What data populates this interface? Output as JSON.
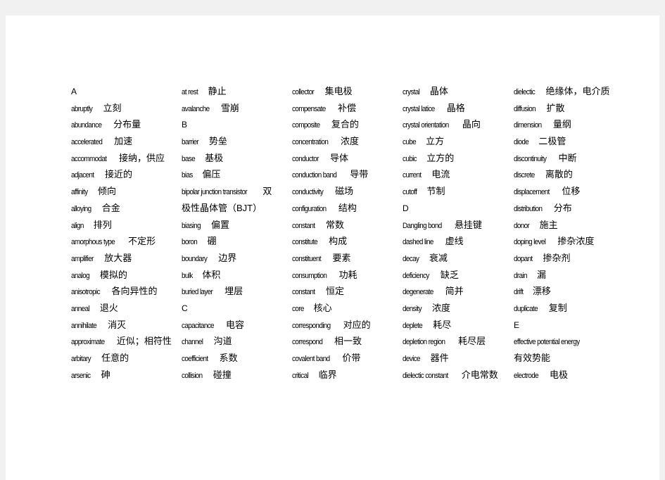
{
  "columns": [
    [
      {
        "heading": "A"
      },
      {
        "en": "abruptly",
        "zh": "立刻"
      },
      {
        "en": "abundance",
        "zh": "分布量"
      },
      {
        "en": "accelerated",
        "zh": "加速"
      },
      {
        "en": "accommodat",
        "zh": "接纳，供应"
      },
      {
        "en": "adjacent",
        "zh": "接近的"
      },
      {
        "en": "affinity",
        "zh": "倾向"
      },
      {
        "en": "alloying",
        "zh": "合金"
      },
      {
        "en": "align",
        "zh": "排列"
      },
      {
        "en": "amorphous type",
        "zh": "不定形"
      },
      {
        "en": "amplifier",
        "zh": "放大器"
      },
      {
        "en": "analog",
        "zh": "模拟的"
      },
      {
        "en": "anisotropic",
        "zh": "各向异性的"
      },
      {
        "en": "anneal",
        "zh": "退火"
      },
      {
        "en": "annihilate",
        "zh": "消灭"
      },
      {
        "en": "approximate",
        "zh": "近似；相符性"
      },
      {
        "en": "arbitary",
        "zh": "任意的"
      },
      {
        "en": "arsenic",
        "zh": "砷"
      }
    ],
    [
      {
        "en": "at rest",
        "zh": "静止"
      },
      {
        "en": "avalanche",
        "zh": "雪崩"
      },
      {
        "heading": "B"
      },
      {
        "en": "barrier",
        "zh": "势垒"
      },
      {
        "en": "base",
        "zh": "基极"
      },
      {
        "en": "bias",
        "zh": "偏压"
      },
      {
        "en": "bipolar junction transistor",
        "zh": "双"
      },
      {
        "zh": "极性晶体管（BJT）"
      },
      {
        "en": "biasing",
        "zh": "偏置"
      },
      {
        "en": "boron",
        "zh": "硼"
      },
      {
        "en": "boundary",
        "zh": "边界"
      },
      {
        "en": "bulk",
        "zh": "体积"
      },
      {
        "en": "buried layer",
        "zh": "埋层"
      },
      {
        "heading": "C"
      },
      {
        "en": "capacitance",
        "zh": "电容"
      },
      {
        "en": "channel",
        "zh": "沟道"
      },
      {
        "en": "coefficient",
        "zh": "系数"
      },
      {
        "en": "collision",
        "zh": "碰撞"
      }
    ],
    [
      {
        "en": "collector",
        "zh": "集电极"
      },
      {
        "en": "compensate",
        "zh": "补偿"
      },
      {
        "en": "composite",
        "zh": "复合的"
      },
      {
        "en": "concentration",
        "zh": "浓度"
      },
      {
        "en": "conductor",
        "zh": "导体"
      },
      {
        "en": "conduction band",
        "zh": "导带"
      },
      {
        "en": "conductivity",
        "zh": "磁场"
      },
      {
        "en": "configuration",
        "zh": "结构"
      },
      {
        "en": "constant",
        "zh": "常数"
      },
      {
        "en": "constitute",
        "zh": "构成"
      },
      {
        "en": "constituent",
        "zh": "要素"
      },
      {
        "en": "consumption",
        "zh": "功耗"
      },
      {
        "en": "constant",
        "zh": "恒定"
      },
      {
        "en": "core",
        "zh": "核心"
      },
      {
        "en": "corresponding",
        "zh": "对应的"
      },
      {
        "en": "correspond",
        "zh": "相一致"
      },
      {
        "en": "covalent band",
        "zh": "价带"
      },
      {
        "en": "critical",
        "zh": "临界"
      }
    ],
    [
      {
        "en": "crystal",
        "zh": "晶体"
      },
      {
        "en": "crystal latice",
        "zh": "晶格"
      },
      {
        "en": "crystal orientation",
        "zh": "晶向"
      },
      {
        "en": "cube",
        "zh": "立方"
      },
      {
        "en": "cubic",
        "zh": "立方的"
      },
      {
        "en": "current",
        "zh": "电流"
      },
      {
        "en": "cutoff",
        "zh": "节制"
      },
      {
        "heading": "D"
      },
      {
        "en": "Dangling bond",
        "zh": "悬挂键"
      },
      {
        "en": "dashed line",
        "zh": "虚线"
      },
      {
        "en": "decay",
        "zh": "衰减"
      },
      {
        "en": "deficiency",
        "zh": "缺乏"
      },
      {
        "en": "degenerate",
        "zh": "简并"
      },
      {
        "en": "density",
        "zh": "浓度"
      },
      {
        "en": "deplete",
        "zh": "耗尽"
      },
      {
        "en": "depletion region",
        "zh": "耗尽层"
      },
      {
        "en": "device",
        "zh": "器件"
      },
      {
        "en": "dielectic constant",
        "zh": "介电常数"
      }
    ],
    [
      {
        "en": "dielectic",
        "zh": "绝缘体，电介质"
      },
      {
        "en": "diffusion",
        "zh": "扩散"
      },
      {
        "en": "dimension",
        "zh": "量纲"
      },
      {
        "en": "diode",
        "zh": "二极管"
      },
      {
        "en": "discontinuity",
        "zh": "中断"
      },
      {
        "en": "discrete",
        "zh": "离散的"
      },
      {
        "en": "displacement",
        "zh": "位移"
      },
      {
        "en": "distribution",
        "zh": "分布"
      },
      {
        "en": "donor",
        "zh": "施主"
      },
      {
        "en": "doping level",
        "zh": "掺杂浓度"
      },
      {
        "en": "dopant",
        "zh": "掺杂剂"
      },
      {
        "en": "drain",
        "zh": "漏"
      },
      {
        "en": "drift",
        "zh": "漂移"
      },
      {
        "en": "duplicate",
        "zh": "复制"
      },
      {
        "heading": "E"
      },
      {
        "en": "effective      potential      energy"
      },
      {
        "zh": "有效势能"
      },
      {
        "en": "electrode",
        "zh": "电极"
      }
    ]
  ]
}
